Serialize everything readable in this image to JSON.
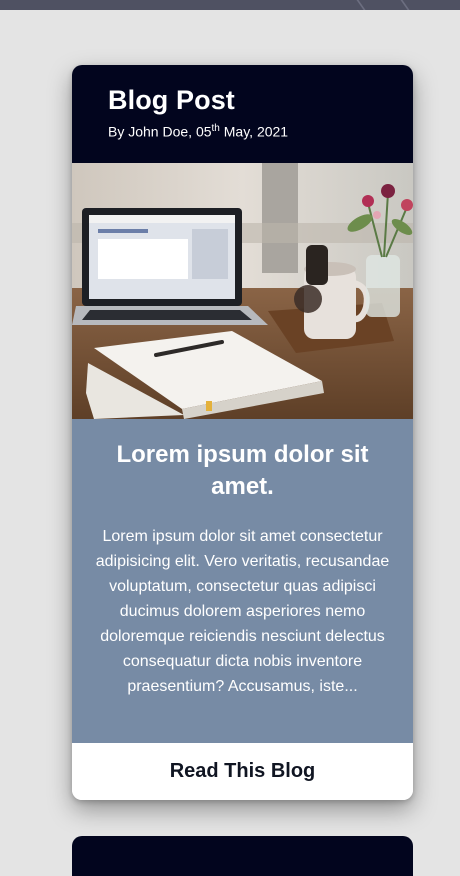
{
  "card": {
    "title": "Blog Post",
    "meta_prefix": "By John Doe, 05",
    "meta_sup": "th",
    "meta_suffix": " May, 2021",
    "heading": "Lorem ipsum dolor sit amet.",
    "excerpt": "Lorem ipsum dolor sit amet consectetur adipisicing elit. Vero veritatis, recusandae voluptatum, consectetur quas adipisci ducimus dolorem asperiores nemo doloremque reiciendis nesciunt delectus consequatur dicta nobis inventore praesentium? Accusamus, iste...",
    "button_label": "Read This Blog"
  },
  "colors": {
    "header_bg": "#02051e",
    "body_bg": "#778ba5",
    "page_bg": "#e4e4e4"
  }
}
